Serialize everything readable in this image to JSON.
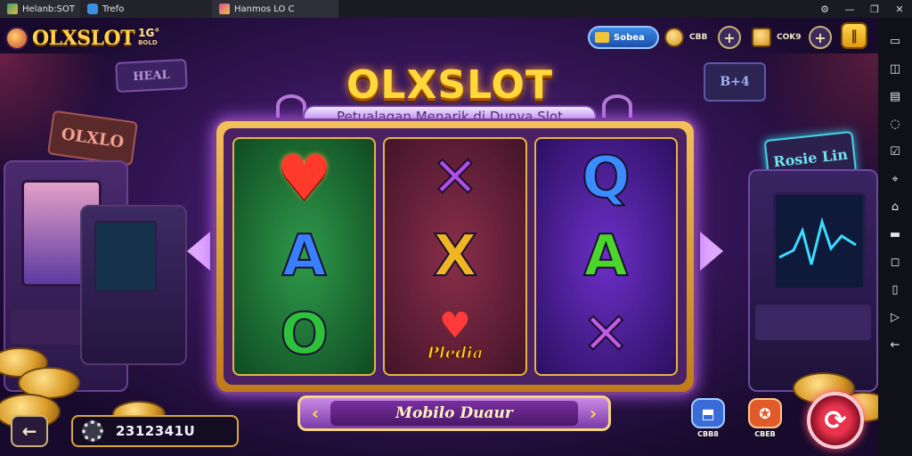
{
  "window": {
    "tabs": [
      {
        "label": "Helanb:SOT"
      },
      {
        "label": "Trefo"
      },
      {
        "label": "Hanmos LO C"
      }
    ],
    "controls": {
      "settings": "⚙",
      "minimize": "—",
      "restore": "❐",
      "close": "✕"
    }
  },
  "sidebar": {
    "icons": [
      "volume-icon",
      "copy-icon",
      "keyboard-icon",
      "rotate-icon",
      "screenshot-icon",
      "location-icon",
      "home-icon",
      "fullscreen-icon",
      "folder-icon",
      "tablet-icon",
      "expand-icon",
      "back-arrow-icon"
    ]
  },
  "header": {
    "logo": {
      "text": "OLXSLOT",
      "badge": "1G°",
      "badge_sub": "BOLD"
    },
    "currency_pill": {
      "label": "Sobea"
    },
    "coins": {
      "value": "CBB"
    },
    "chest": {
      "value": "COK9"
    },
    "plus_label": "+",
    "menu_label": "‖"
  },
  "machine": {
    "title": "OLXSLOT",
    "subtitle": "Petualagan Menarik di Dunya Slot",
    "reels": [
      [
        {
          "name": "heart",
          "glyph": "♥"
        },
        {
          "name": "letter-a",
          "glyph": "A",
          "color": "#3a7fff"
        },
        {
          "name": "green-o",
          "glyph": "O",
          "color": "#2ec13a"
        }
      ],
      [
        {
          "name": "purple-x",
          "glyph": "✕",
          "color": "#b24ee8"
        },
        {
          "name": "letter-x",
          "glyph": "X",
          "color": "#f0b523"
        },
        {
          "name": "heart-badge",
          "glyph": "Pledia",
          "color": "#ffcc3a"
        }
      ],
      [
        {
          "name": "letter-q",
          "glyph": "Q",
          "color": "#3a8cff"
        },
        {
          "name": "letter-a",
          "glyph": "A",
          "color": "#4ad62a"
        },
        {
          "name": "purple-x",
          "glyph": "✕",
          "color": "#c45ae8"
        }
      ]
    ],
    "selector": {
      "label": "Mobilo Duaur",
      "prev": "‹",
      "next": "›"
    }
  },
  "bottom": {
    "back_label": "←",
    "balance": "2312341U",
    "actions": [
      {
        "label": "CBB8",
        "icon": "⬒",
        "face": "#3a6bd8"
      },
      {
        "label": "CBEB",
        "icon": "✪",
        "face": "#e05a2a"
      }
    ],
    "spin_label": "⟳"
  },
  "scenery": {
    "signs": [
      "HEAL",
      "OLXLO",
      "B+4",
      "Rosie Lin"
    ]
  },
  "colors": {
    "accent_gold": "#ffd83a",
    "brand_purple": "#4a2264",
    "spin_red": "#e8334f"
  }
}
